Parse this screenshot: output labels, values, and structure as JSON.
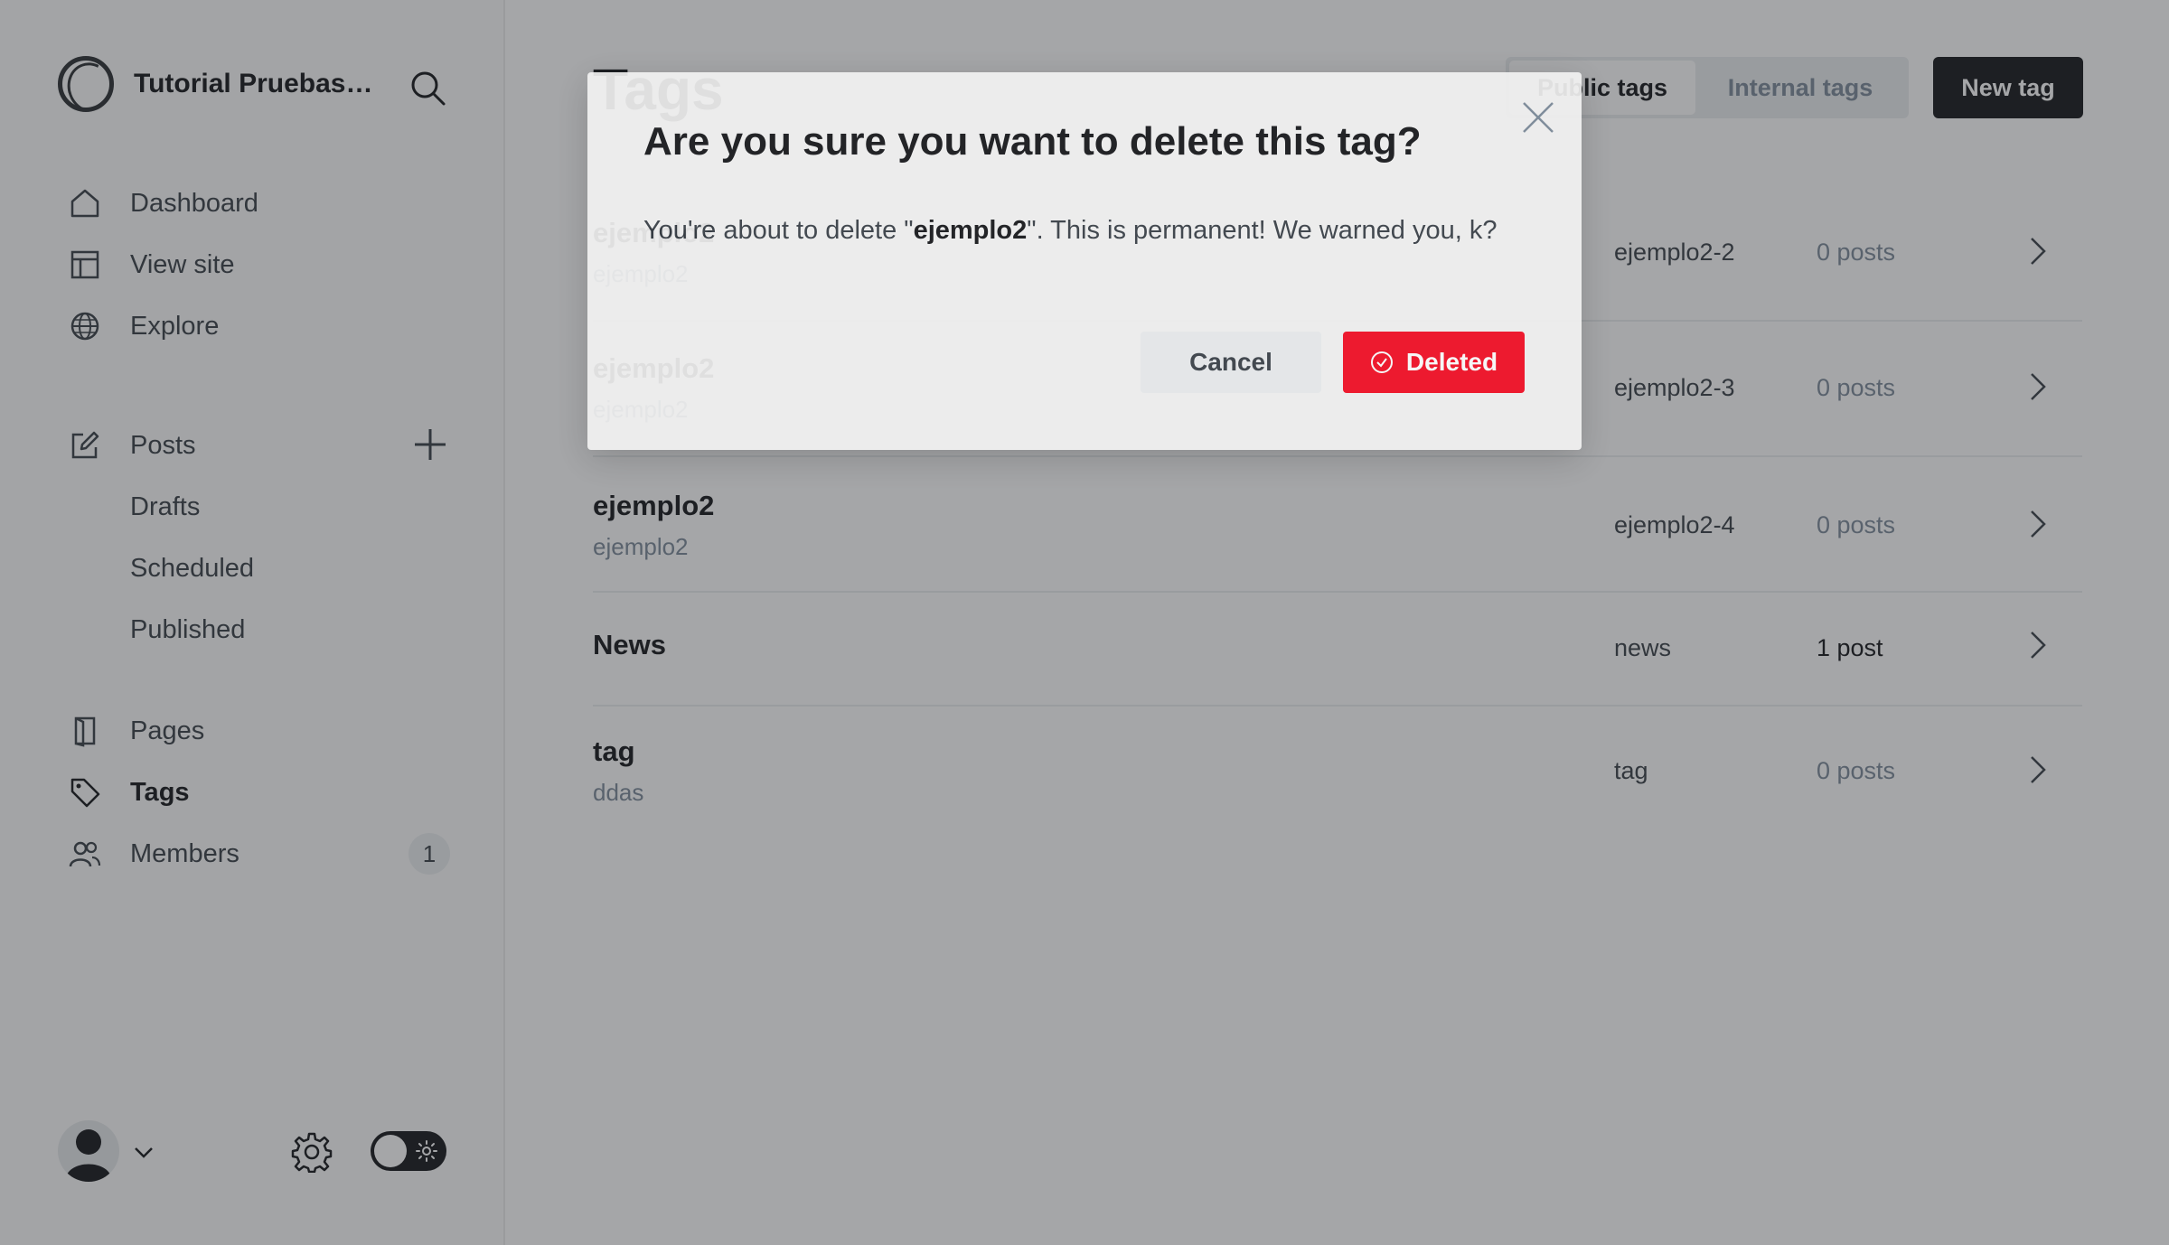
{
  "sidebar": {
    "site_title": "Tutorial Pruebas Automatizadas",
    "nav": [
      {
        "label": "Dashboard",
        "icon": "home-icon"
      },
      {
        "label": "View site",
        "icon": "layout-icon"
      },
      {
        "label": "Explore",
        "icon": "globe-icon"
      },
      {
        "label": "Posts",
        "icon": "edit-icon"
      }
    ],
    "posts_sub": [
      "Drafts",
      "Scheduled",
      "Published"
    ],
    "nav2": [
      {
        "label": "Pages",
        "icon": "page-icon"
      },
      {
        "label": "Tags",
        "icon": "tag-icon",
        "active": true
      },
      {
        "label": "Members",
        "icon": "members-icon",
        "badge": "1"
      }
    ]
  },
  "main": {
    "title": "Tags",
    "tabs": [
      {
        "label": "Public tags",
        "active": true
      },
      {
        "label": "Internal tags",
        "active": false
      }
    ],
    "new_tag_label": "New tag",
    "tags": [
      {
        "name": "ejemplo2",
        "description": "ejemplo2",
        "slug": "ejemplo2-2",
        "count": "0 posts"
      },
      {
        "name": "ejemplo2",
        "description": "ejemplo2",
        "slug": "ejemplo2-3",
        "count": "0 posts"
      },
      {
        "name": "ejemplo2",
        "description": "ejemplo2",
        "slug": "ejemplo2-4",
        "count": "0 posts"
      },
      {
        "name": "News",
        "description": "",
        "slug": "news",
        "count": "1 post"
      },
      {
        "name": "tag",
        "description": "ddas",
        "slug": "tag",
        "count": "0 posts"
      }
    ]
  },
  "modal": {
    "title": "Are you sure you want to delete this tag?",
    "body_prefix": "You're about to delete \"",
    "body_tag": "ejemplo2",
    "body_suffix": "\". This is permanent! We warned you, k?",
    "cancel_label": "Cancel",
    "delete_label": "Deleted"
  },
  "colors": {
    "accent_dark": "#15171a",
    "danger": "#f50b23",
    "sidebar_bg": "#fbfbfb"
  }
}
